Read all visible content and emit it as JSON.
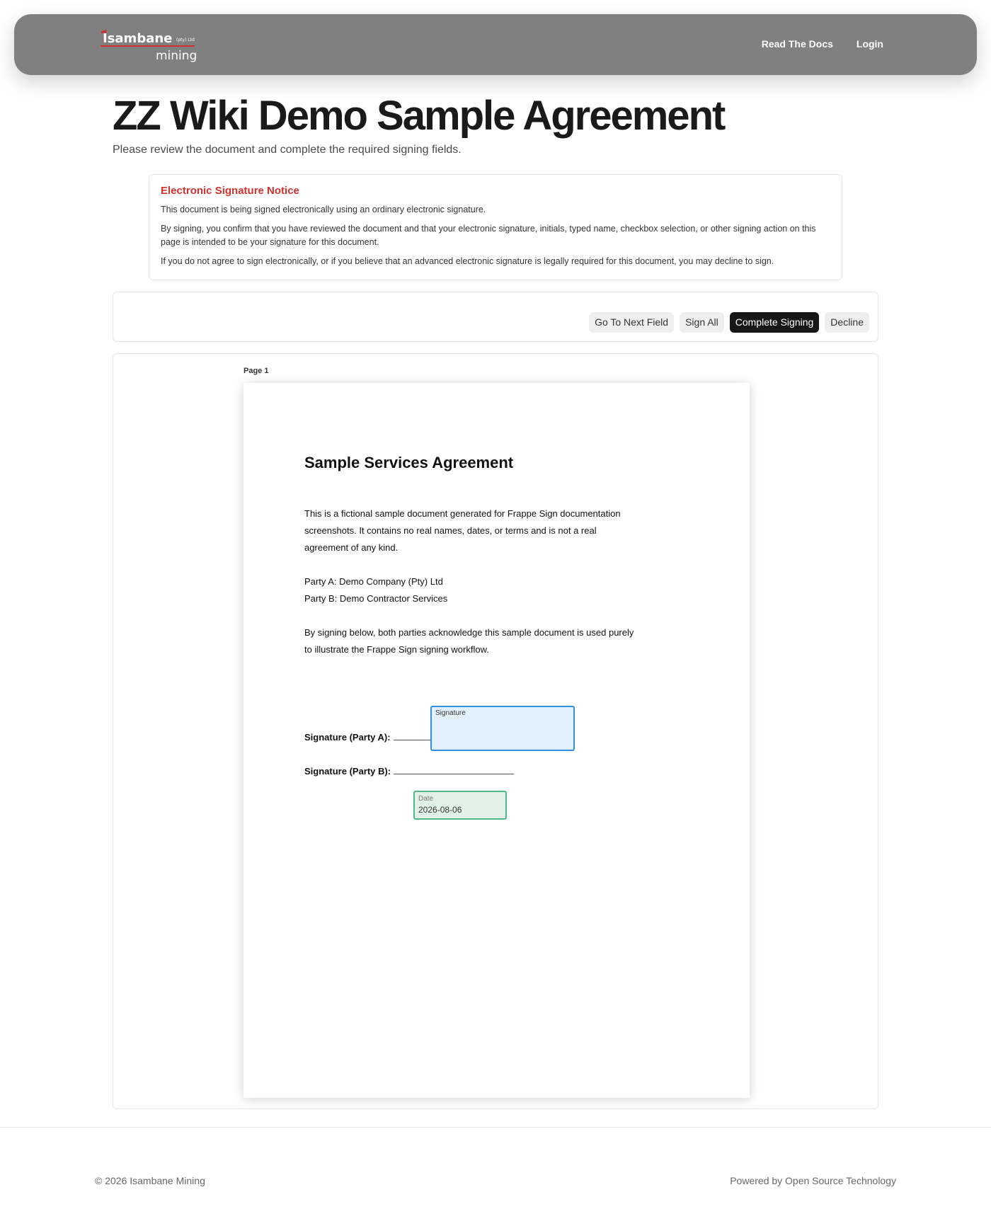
{
  "header": {
    "logo": {
      "word1": "Isambane",
      "word2": "mining",
      "suffix": "(pty) Ltd"
    },
    "nav": [
      {
        "label": "Read The Docs"
      },
      {
        "label": "Login"
      }
    ]
  },
  "page": {
    "title": "ZZ Wiki Demo Sample Agreement",
    "subtitle": "Please review the document and complete the required signing fields."
  },
  "notice": {
    "heading": "Electronic Signature Notice",
    "paragraphs": [
      "This document is being signed electronically using an ordinary electronic signature.",
      "By signing, you confirm that you have reviewed the document and that your electronic signature, initials, typed name, checkbox selection, or other signing action on this page is intended to be your signature for this document.",
      "If you do not agree to sign electronically, or if you believe that an advanced electronic signature is legally required for this document, you may decline to sign."
    ]
  },
  "toolbar": {
    "next_field": "Go To Next Field",
    "sign_all": "Sign All",
    "complete": "Complete Signing",
    "decline": "Decline"
  },
  "viewer": {
    "page_label": "Page 1",
    "doc": {
      "title": "Sample Services Agreement",
      "intro": "This is a fictional sample document generated for Frappe Sign documentation screenshots. It contains no real names, dates, or terms and is not a real agreement of any kind.",
      "party_a": "Party A: Demo Company (Pty) Ltd",
      "party_b": "Party B: Demo Contractor Services",
      "acknowledge": "By signing below, both parties acknowledge this sample document is used purely to illustrate the Frappe Sign signing workflow.",
      "sig_a_label": "Signature (Party A):",
      "sig_b_label": "Signature (Party B):"
    },
    "fields": {
      "signature_label": "Signature",
      "date_label": "Date",
      "date_value": "2026-08-06"
    }
  },
  "footer": {
    "copyright": "© 2026 Isambane Mining",
    "powered": "Powered by Open Source Technology"
  },
  "colors": {
    "header_bg": "#808080",
    "notice_heading": "#d0312d",
    "primary_button": "#171717",
    "signature_field_border": "#2f8fe0",
    "date_field_border": "#52b788"
  }
}
